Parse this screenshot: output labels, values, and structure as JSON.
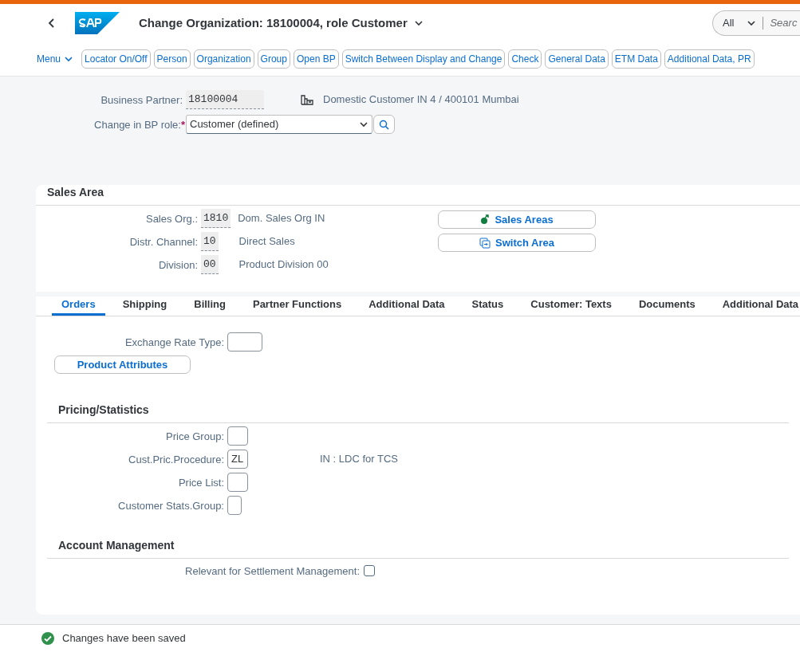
{
  "header": {
    "title": "Change Organization: 18100004, role Customer",
    "search": {
      "scope": "All",
      "placeholder": "Searc"
    }
  },
  "toolbar": {
    "menu": "Menu",
    "buttons": [
      "Locator On/Off",
      "Person",
      "Organization",
      "Group",
      "Open BP",
      "Switch Between Display and Change",
      "Check",
      "General Data",
      "ETM Data",
      "Additional Data, PR"
    ]
  },
  "bp": {
    "business_partner": {
      "label": "Business Partner:",
      "value": "18100004",
      "description": "Domestic Customer IN 4 / 400101 Mumbai"
    },
    "role": {
      "label": "Change in BP role:",
      "required_mark": "*",
      "value": "Customer (defined)"
    }
  },
  "sales_area": {
    "title": "Sales Area",
    "fields": [
      {
        "label": "Sales Org.:",
        "value": "1810",
        "description": "Dom. Sales Org IN"
      },
      {
        "label": "Distr. Channel:",
        "value": "10",
        "description": "Direct Sales"
      },
      {
        "label": "Division:",
        "value": "00",
        "description": "Product Division 00"
      }
    ],
    "buttons": [
      "Sales Areas",
      "Switch Area"
    ]
  },
  "tabs": [
    {
      "label": "Orders",
      "selected": true
    },
    {
      "label": "Shipping",
      "selected": false
    },
    {
      "label": "Billing",
      "selected": false
    },
    {
      "label": "Partner Functions",
      "selected": false
    },
    {
      "label": "Additional Data",
      "selected": false
    },
    {
      "label": "Status",
      "selected": false
    },
    {
      "label": "Customer: Texts",
      "selected": false
    },
    {
      "label": "Documents",
      "selected": false
    },
    {
      "label": "Additional Data",
      "selected": false
    }
  ],
  "orders": {
    "fields": [
      {
        "label": "Exchange Rate Type:"
      }
    ],
    "button": "Product Attributes"
  },
  "pricing": {
    "title": "Pricing/Statistics",
    "fields": [
      {
        "label": "Price Group:"
      },
      {
        "label": "Cust.Pric.Procedure:",
        "value": "ZL",
        "description": "IN : LDC for TCS"
      },
      {
        "label": "Price List:"
      },
      {
        "label": "Customer Stats.Group:",
        "narrow": true
      }
    ]
  },
  "account": {
    "title": "Account Management",
    "fields": [
      {
        "label": "Relevant for Settlement Management:",
        "checked": false
      }
    ]
  },
  "status": {
    "kind": "success",
    "message": "Changes have been saved"
  }
}
